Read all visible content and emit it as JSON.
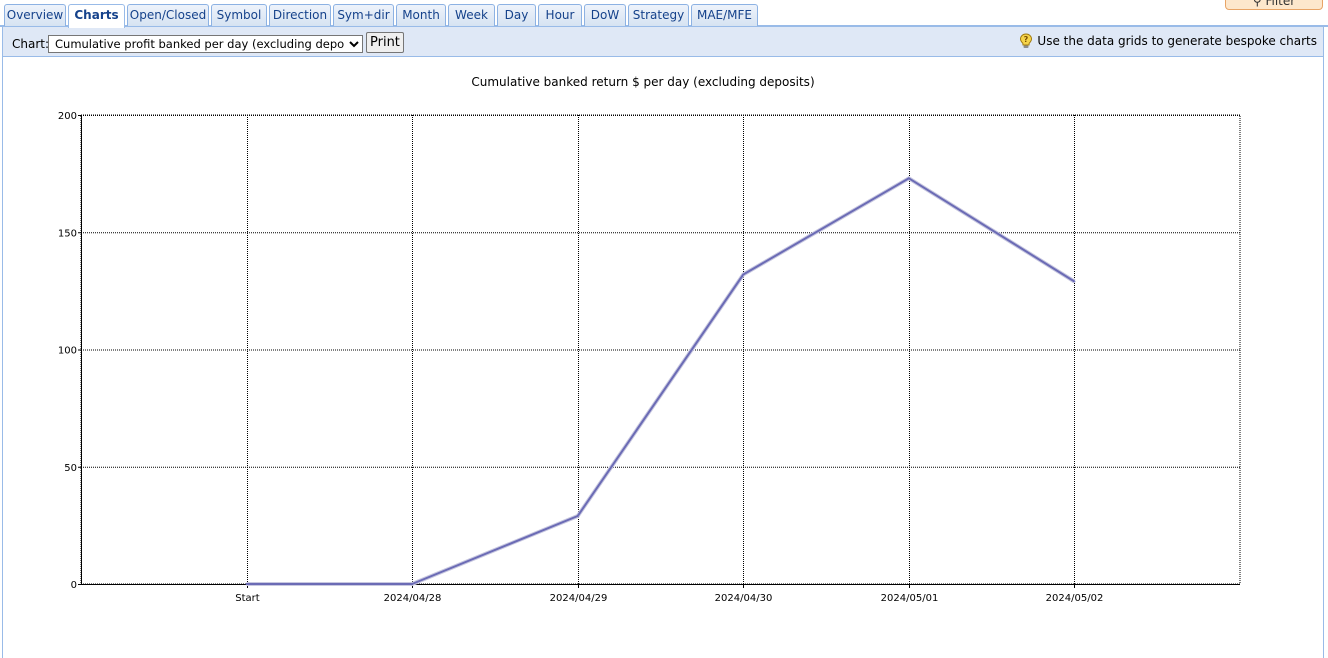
{
  "tabs": [
    {
      "label": "Overview",
      "active": false
    },
    {
      "label": "Charts",
      "active": true
    },
    {
      "label": "Open/Closed",
      "active": false
    },
    {
      "label": "Symbol",
      "active": false
    },
    {
      "label": "Direction",
      "active": false
    },
    {
      "label": "Sym+dir",
      "active": false
    },
    {
      "label": "Month",
      "active": false
    },
    {
      "label": "Week",
      "active": false
    },
    {
      "label": "Day",
      "active": false
    },
    {
      "label": "Hour",
      "active": false
    },
    {
      "label": "DoW",
      "active": false
    },
    {
      "label": "Strategy",
      "active": false
    },
    {
      "label": "MAE/MFE",
      "active": false
    }
  ],
  "filter_label": "Filter",
  "toolbar": {
    "chart_label": "Chart:",
    "chart_selected": "Cumulative profit banked per day (excluding deposits)",
    "print_label": "Print",
    "hint": "Use the data grids to generate bespoke charts",
    "hint_icon": "lightbulb-help-icon"
  },
  "colors": {
    "series_line": "#6b6bb5",
    "tab_text": "#15428b",
    "tab_border": "#99bbe8",
    "toolbar_bg": "#dfe8f6"
  },
  "chart_data": {
    "type": "line",
    "title": "Cumulative banked return $ per day (excluding deposits)",
    "categories": [
      "Start",
      "2024/04/28",
      "2024/04/29",
      "2024/04/30",
      "2024/05/01",
      "2024/05/02"
    ],
    "series": [
      {
        "values": [
          0,
          0,
          29,
          132,
          173,
          129
        ]
      }
    ],
    "ylim": [
      0,
      200
    ],
    "yticks": [
      0,
      50,
      100,
      150,
      200
    ],
    "grid": true,
    "legend": "none"
  }
}
